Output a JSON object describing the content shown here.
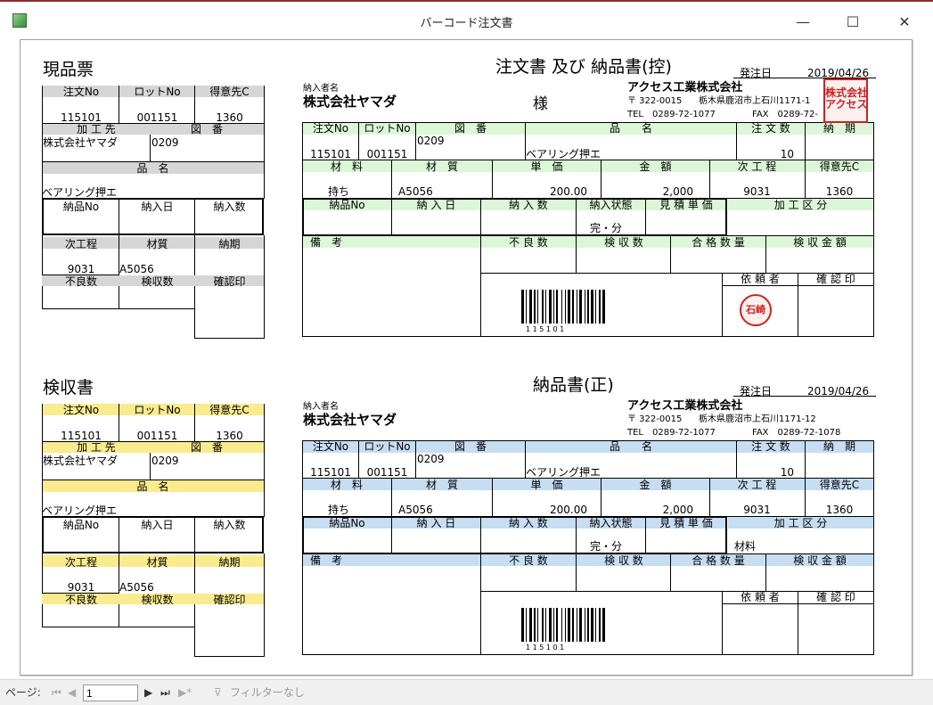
{
  "window": {
    "title": "バーコード注文書",
    "min": "—",
    "max": "☐",
    "close": "✕"
  },
  "top": {
    "left_title": "現品票",
    "main_title": "注文書 及び 納品書(控)",
    "order_date_label": "発注日",
    "order_date": "2019/04/26",
    "stamp": "株式会社\nアクセス",
    "seal": "石崎"
  },
  "bottom": {
    "left_title": "検収書",
    "main_title": "納品書(正)",
    "order_date_label": "発注日",
    "order_date": "2019/04/26",
    "extra_material": "材料"
  },
  "labels": {
    "order_no": "注文No",
    "lot_no": "ロットNo",
    "customer_c": "得意先C",
    "processor": "加 工 先",
    "drawing": "図　番",
    "product": "品　名",
    "delivery_no": "納品No",
    "arrival_date": "納入日",
    "arrival_qty": "納入数",
    "next_process": "次工程",
    "material_q": "材質",
    "due": "納期",
    "defect_qty": "不良数",
    "inspect_qty": "検収数",
    "confirm_seal": "確認印",
    "recipient_label": "納入者名",
    "sama": "様",
    "r_order_no": "注文No",
    "r_lot_no": "ロットNo",
    "r_drawing": "図　番",
    "r_product": "品　　名",
    "r_order_qty": "注 文 数",
    "r_due": "納　期",
    "r_material": "材　料",
    "r_material_q": "材　質",
    "r_unit_price": "単　価",
    "r_amount": "金　額",
    "r_next": "次 工 程",
    "r_customer_c": "得意先C",
    "r_delivery_no": "納品No",
    "r_arrival_date": "納 入 日",
    "r_arrival_qty": "納 入 数",
    "r_status": "納入状態",
    "r_estimate": "見 積 単 価",
    "r_process_class": "加 工 区 分",
    "r_remarks": "備　考",
    "r_defect": "不 良 数",
    "r_inspect": "検 収 数",
    "r_pass": "合 格 数 量",
    "r_inspect_amount": "検 収 金 額",
    "r_requester": "依 頼 者",
    "r_confirm": "確 認 印"
  },
  "company": {
    "name": "アクセス工業株式会社",
    "zip": "〒 322-0015",
    "address": "栃木県鹿沼市上石川1171-12",
    "address_top": "栃木県鹿沼市上石川1171-1",
    "tel": "TEL　0289-72-1077",
    "fax": "FAX　0289-72-1078",
    "fax_top": "FAX　0289-72-"
  },
  "record": {
    "order_no": "115101",
    "lot_no": "001151",
    "customer_c": "1360",
    "processor": "株式会社ヤマダ",
    "drawing": "0209",
    "product": "ベアリング押エ",
    "next_process": "9031",
    "material_q": "A5056",
    "recipient": "株式会社ヤマダ",
    "order_qty": "10",
    "material": "持ち",
    "unit_price": "200.00",
    "amount": "2,000",
    "status": "完・分",
    "barcode_digits": "1 1 5 1 0 1"
  },
  "statusbar": {
    "page_label": "ページ:",
    "page_value": "1",
    "filter": "フィルターなし"
  }
}
